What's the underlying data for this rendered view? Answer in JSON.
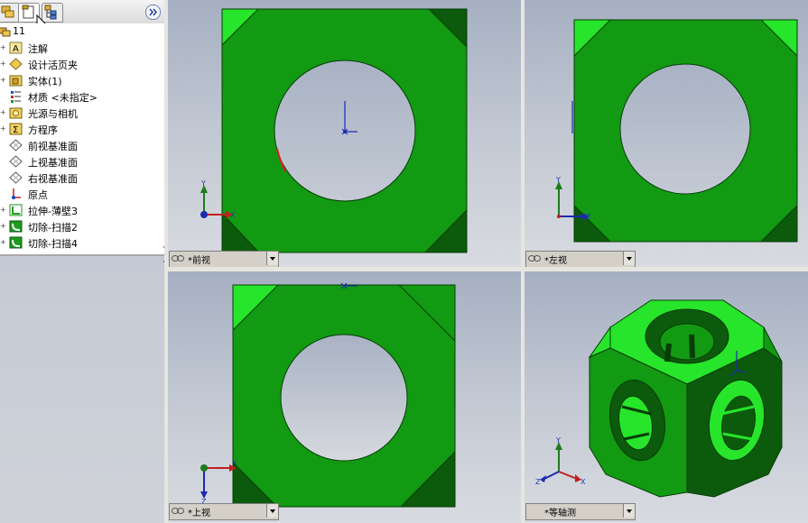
{
  "tree": {
    "root_label": "11",
    "items": [
      {
        "label": "注解"
      },
      {
        "label": "设计活页夹"
      },
      {
        "label": "实体(1)"
      },
      {
        "label": "材质 <未指定>"
      },
      {
        "label": "光源与相机"
      },
      {
        "label": "方程序"
      },
      {
        "label": "前视基准面"
      },
      {
        "label": "上视基准面"
      },
      {
        "label": "右视基准面"
      },
      {
        "label": "原点"
      },
      {
        "label": "拉伸-薄壁3"
      },
      {
        "label": "切除-扫描2"
      },
      {
        "label": "切除-扫描4"
      }
    ]
  },
  "viewports": {
    "front": {
      "name": "*前视"
    },
    "left": {
      "name": "*左视"
    },
    "top": {
      "name": "*上视"
    },
    "iso": {
      "name": "*等轴测"
    }
  },
  "axes": {
    "x": "X",
    "y": "Y",
    "z": "Z"
  },
  "colors": {
    "part_green": "#129a12",
    "bright_green": "#27e52a",
    "dark_green": "#0c5a0c"
  },
  "icons": {
    "expand": "double-chevron-right-icon"
  }
}
